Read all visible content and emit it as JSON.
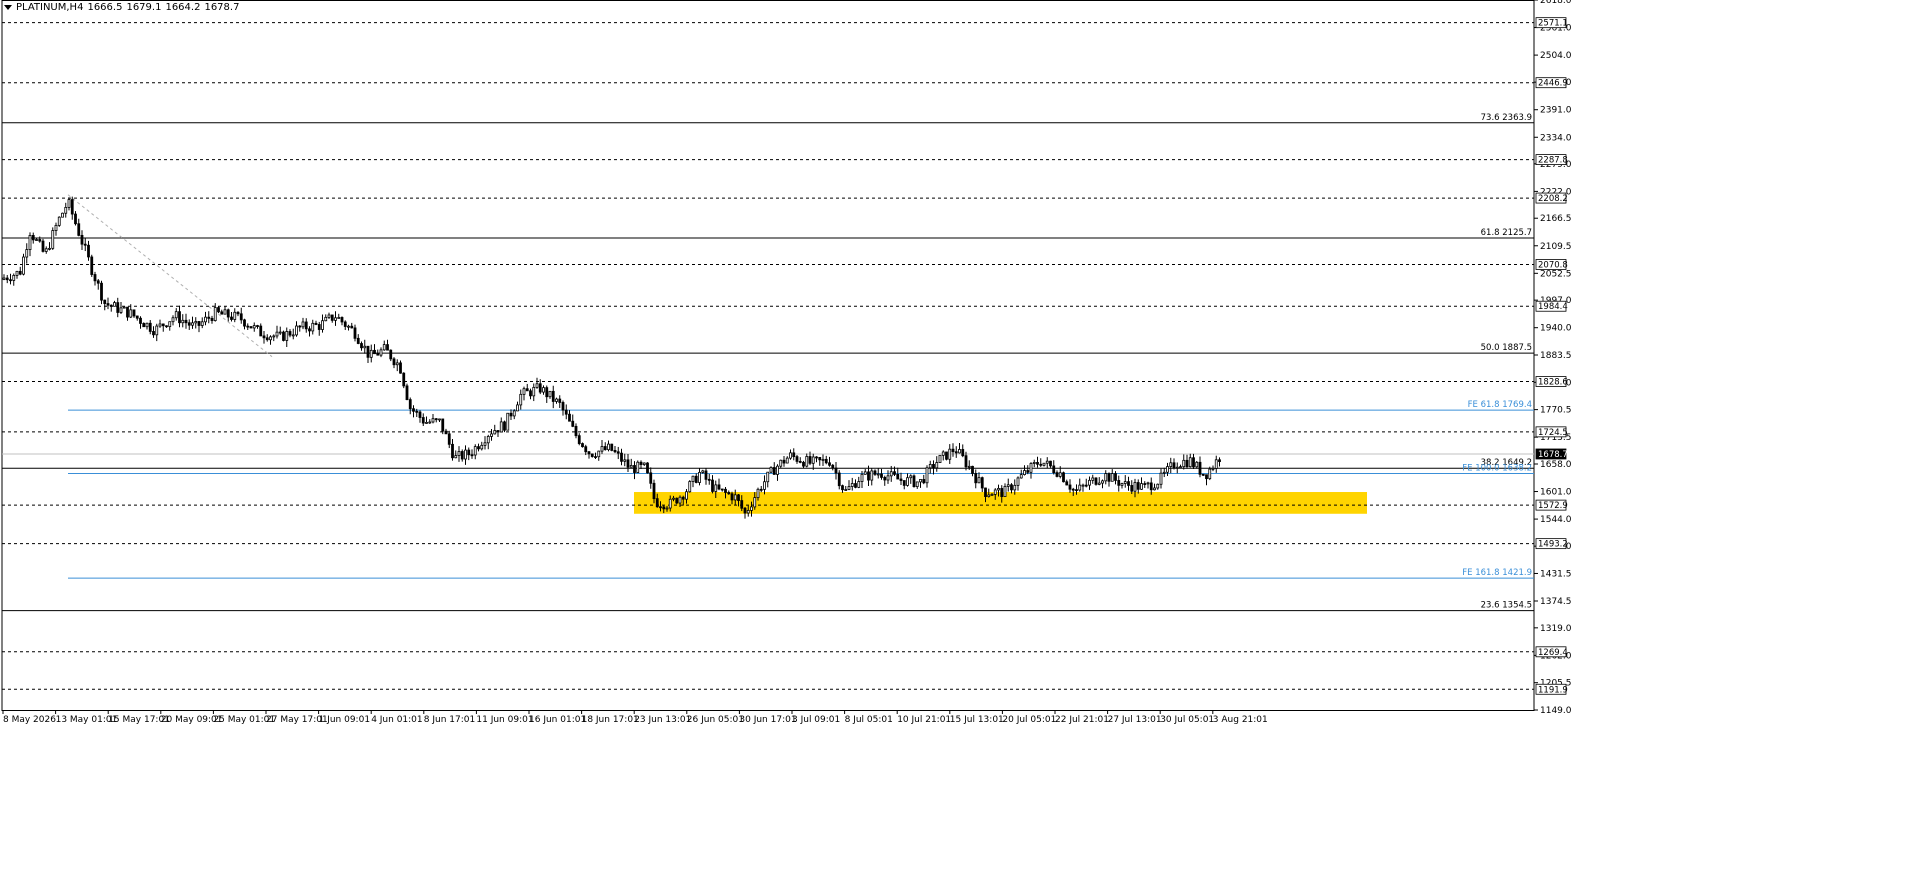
{
  "header": {
    "symbol": "PLATINUM,H4",
    "open": "1666.5",
    "high": "1679.1",
    "low": "1664.2",
    "close": "1678.7"
  },
  "chart_data": {
    "type": "candlestick",
    "symbol": "PLATINUM",
    "timeframe": "H4",
    "ylim": [
      1149,
      2618
    ],
    "y_ticks": [
      2618.0,
      2561.0,
      2504.0,
      2448.0,
      2391.0,
      2334.0,
      2279.0,
      2222.0,
      2166.5,
      2109.5,
      2052.5,
      1997.0,
      1940.0,
      1883.5,
      1827.0,
      1770.5,
      1713.5,
      1658.0,
      1601.0,
      1544.0,
      1488.0,
      1431.5,
      1374.5,
      1319.0,
      1262.0,
      1205.5,
      1149.0
    ],
    "x_ticks": [
      "8 May 2026",
      "13 May 01:01",
      "15 May 17:01",
      "20 May 09:01",
      "25 May 01:01",
      "27 May 17:01",
      "1 Jun 09:01",
      "4 Jun 01:01",
      "8 Jun 17:01",
      "11 Jun 09:01",
      "16 Jun 01:01",
      "18 Jun 17:01",
      "23 Jun 13:01",
      "26 Jun 05:01",
      "30 Jun 17:01",
      "3 Jul 09:01",
      "8 Jul 05:01",
      "10 Jul 21:01",
      "15 Jul 13:01",
      "20 Jul 05:01",
      "22 Jul 21:01",
      "27 Jul 13:01",
      "30 Jul 05:01",
      "3 Aug 21:01"
    ],
    "current_price": "1678.7",
    "horizontal_levels": [
      {
        "value": "2571.1",
        "style": "dashed",
        "tag": true
      },
      {
        "value": "2446.9",
        "style": "dashed",
        "tag": true
      },
      {
        "value": "2287.8",
        "style": "dashed",
        "tag": true
      },
      {
        "value": "2208.2",
        "style": "dashed",
        "tag": true
      },
      {
        "value": "2070.8",
        "style": "dashed",
        "tag": true
      },
      {
        "value": "1984.4",
        "style": "dashed",
        "tag": true
      },
      {
        "value": "1828.6",
        "style": "dashed",
        "tag": true
      },
      {
        "value": "1724.5",
        "style": "dashed",
        "tag": true
      },
      {
        "value": "1572.9",
        "style": "dashed",
        "tag": true
      },
      {
        "value": "1493.2",
        "style": "dashed",
        "tag": true
      },
      {
        "value": "1269.4",
        "style": "dashed",
        "tag": true
      },
      {
        "value": "1191.9",
        "style": "dashed",
        "tag": true
      }
    ],
    "fibo_retracement": [
      {
        "label": "73.6 2363.9",
        "value": 2363.9
      },
      {
        "label": "61.8 2125.7",
        "value": 2125.7
      },
      {
        "label": "50.0 1887.5",
        "value": 1887.5
      },
      {
        "label": "38.2 1649.2",
        "value": 1649.2
      },
      {
        "label": "23.6 1354.5",
        "value": 1354.5
      }
    ],
    "fibo_expansion": [
      {
        "label": "FE 61.8 1769.4",
        "value": 1769.4
      },
      {
        "label": "FE 100.0 1638.2",
        "value": 1638.2
      },
      {
        "label": "FE 161.8 1421.9",
        "value": 1421.9
      }
    ],
    "support_zone": {
      "from": 1555,
      "to": 1600,
      "color": "#ffd400"
    },
    "colors": {
      "candle": "#000000",
      "up_body": "#ffffff",
      "down_body": "#000000",
      "fibo": "#000000",
      "expansion": "#3a8fd8",
      "zone": "#ffd400"
    },
    "grid": false
  }
}
